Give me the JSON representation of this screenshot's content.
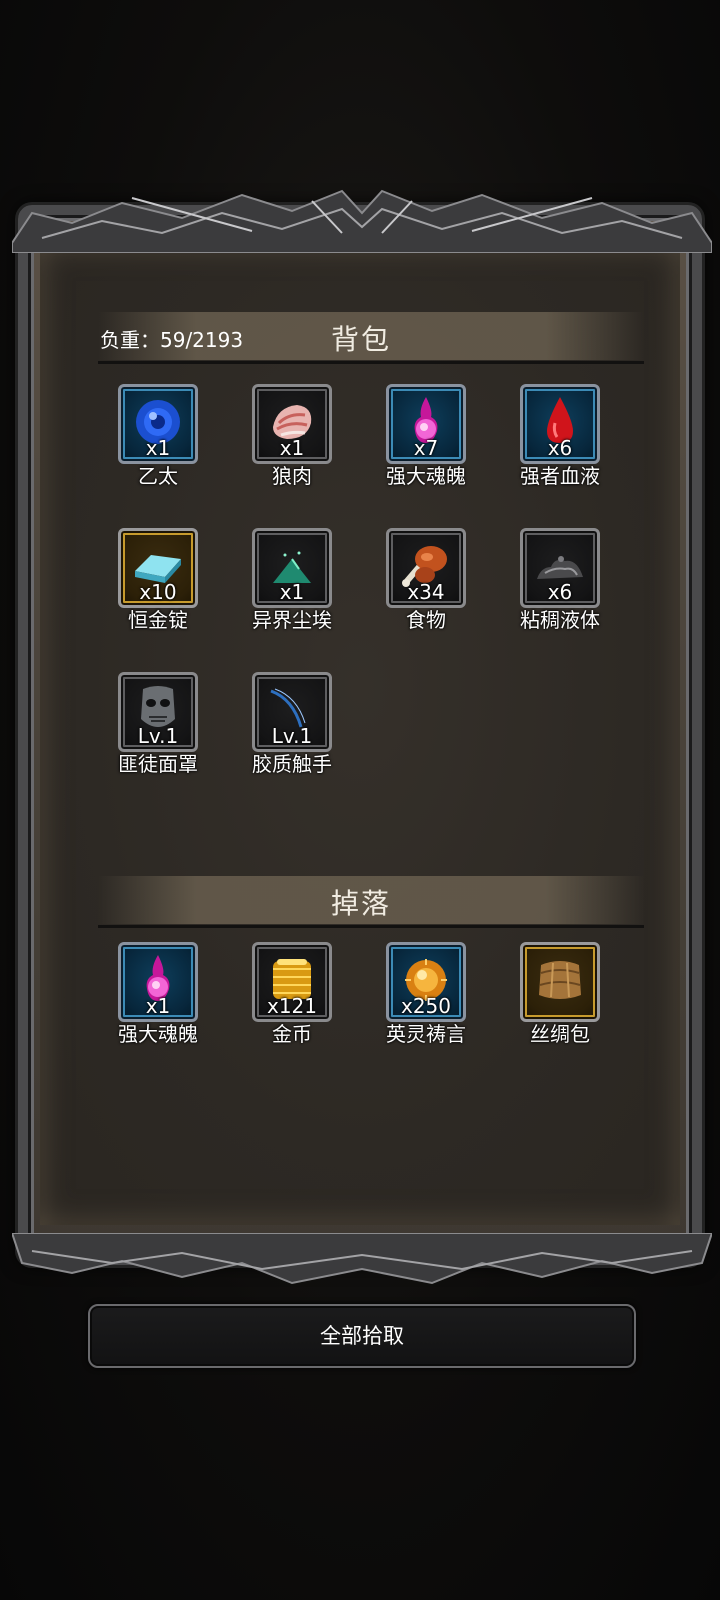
{
  "bag": {
    "title": "背包",
    "load_label": "负重：59/2193",
    "items": [
      {
        "name": "乙太",
        "qty": "x1",
        "icon": "ether-orb-icon",
        "frame": "blue"
      },
      {
        "name": "狼肉",
        "qty": "x1",
        "icon": "wolf-meat-icon",
        "frame": "gray"
      },
      {
        "name": "强大魂魄",
        "qty": "x7",
        "icon": "soul-orb-icon",
        "frame": "blue"
      },
      {
        "name": "强者血液",
        "qty": "x6",
        "icon": "blood-drop-icon",
        "frame": "blue"
      },
      {
        "name": "恒金锭",
        "qty": "x10",
        "icon": "ingot-icon",
        "frame": "gold"
      },
      {
        "name": "异界尘埃",
        "qty": "x1",
        "icon": "dust-pile-icon",
        "frame": "gray"
      },
      {
        "name": "食物",
        "qty": "x34",
        "icon": "food-drumstick-icon",
        "frame": "gray"
      },
      {
        "name": "粘稠液体",
        "qty": "x6",
        "icon": "slime-icon",
        "frame": "gray"
      },
      {
        "name": "匪徒面罩",
        "qty": "Lv.1",
        "icon": "bandit-mask-icon",
        "frame": "gray"
      },
      {
        "name": "胶质触手",
        "qty": "Lv.1",
        "icon": "tentacle-icon",
        "frame": "gray"
      }
    ]
  },
  "drops": {
    "title": "掉落",
    "items": [
      {
        "name": "强大魂魄",
        "qty": "x1",
        "icon": "soul-orb-icon",
        "frame": "blue"
      },
      {
        "name": "金币",
        "qty": "x121",
        "icon": "gold-coins-icon",
        "frame": "gray"
      },
      {
        "name": "英灵祷言",
        "qty": "x250",
        "icon": "spirit-prayer-icon",
        "frame": "blue"
      },
      {
        "name": "丝绸包",
        "qty": "",
        "icon": "silk-bag-icon",
        "frame": "gold"
      }
    ]
  },
  "actions": {
    "pick_all_label": "全部拾取"
  },
  "colors": {
    "frame_blue": "#3c8bb6",
    "frame_gold": "#c79b2d",
    "panel_bg": "#2d2924"
  }
}
